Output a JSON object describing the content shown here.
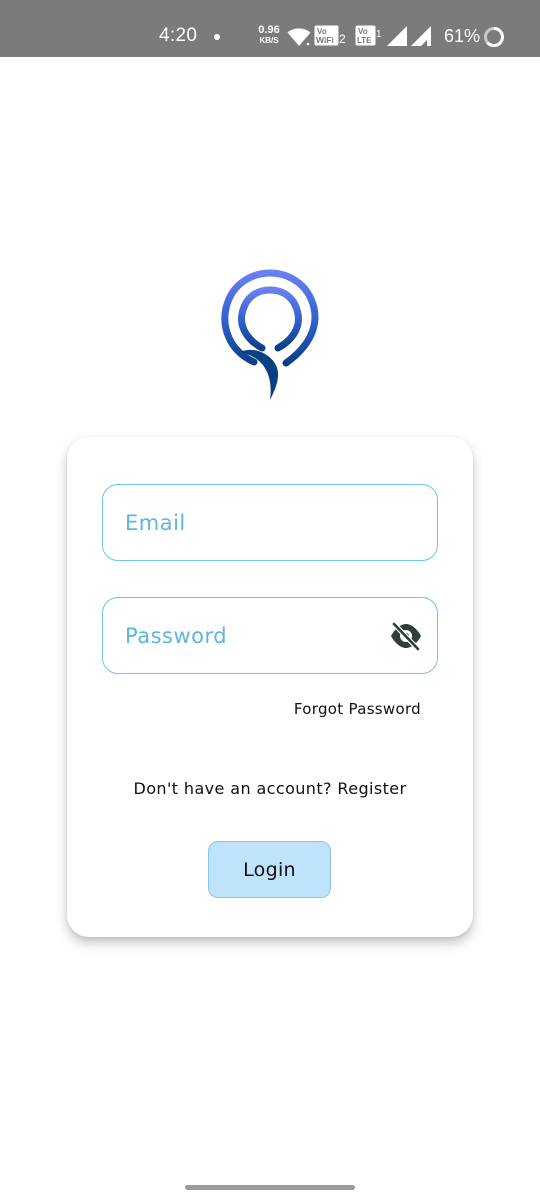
{
  "status_bar": {
    "time": "4:20",
    "net_speed_value": "0.96",
    "net_speed_unit": "KB/S",
    "vowifi_label": "Vo WiFi 2",
    "volte_label": "Vo LTE 1",
    "battery_percent": "61%",
    "icons": [
      "dot-indicator",
      "wifi-icon",
      "vowifi-icon",
      "volte-icon",
      "signal-icon",
      "signal-icon",
      "battery-ring-icon"
    ]
  },
  "logo": {
    "icon": "location-pin-logo",
    "colors": [
      "#6a7ff0",
      "#1f52b8",
      "#0b3f85"
    ]
  },
  "login_form": {
    "email_placeholder": "Email",
    "password_placeholder": "Password",
    "password_toggle_icon": "eye-off-icon",
    "forgot_password": "Forgot Password",
    "no_account_text": "Don't have an account?",
    "register_link": "Register",
    "login_button": "Login"
  },
  "colors": {
    "accent": "#5cb6e0",
    "field_border": "#6ec3ea",
    "button_bg": "#bee3fb",
    "status_bar_bg": "#7b7b7b"
  }
}
